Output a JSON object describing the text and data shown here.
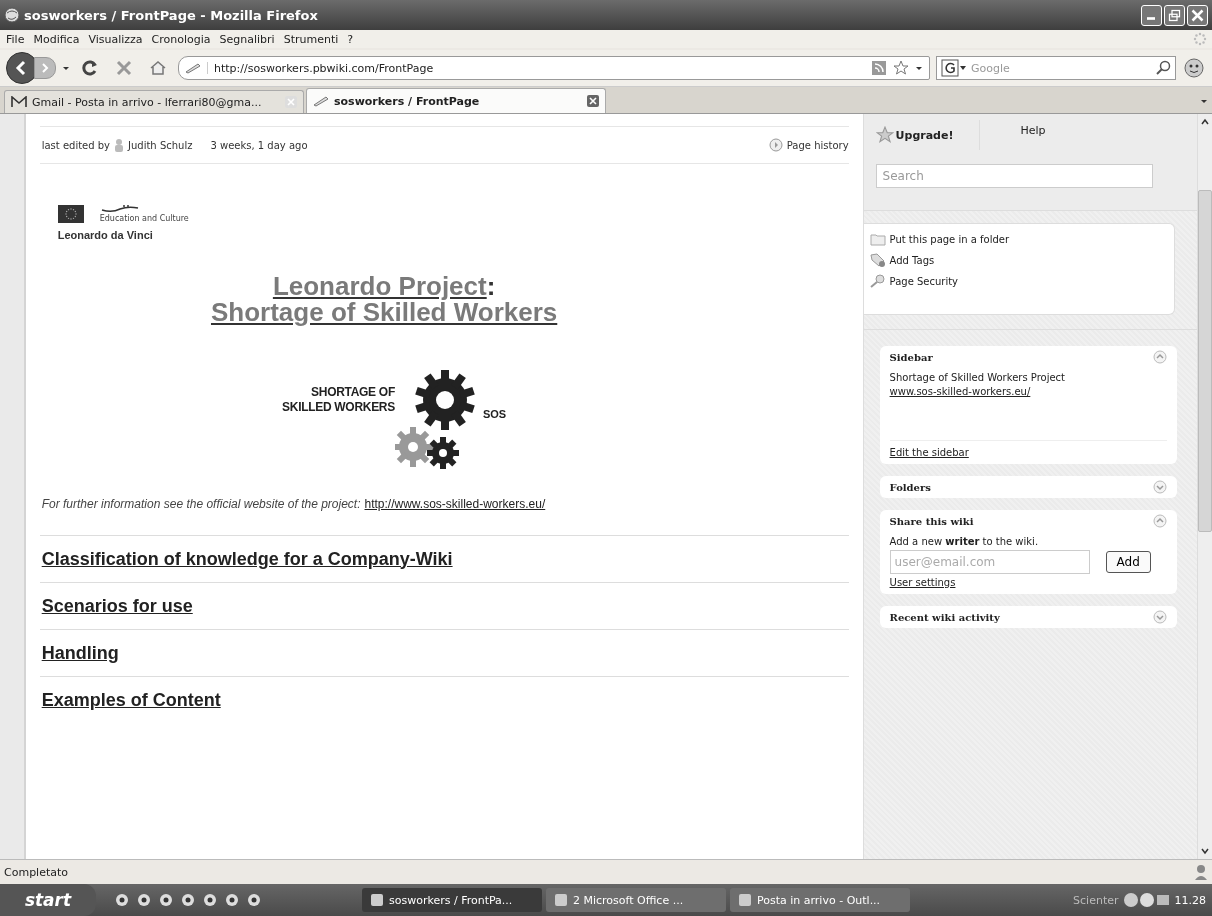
{
  "window": {
    "title": "sosworkers / FrontPage - Mozilla Firefox"
  },
  "menu": [
    "File",
    "Modifica",
    "Visualizza",
    "Cronologia",
    "Segnalibri",
    "Strumenti",
    "?"
  ],
  "toolbar": {
    "url": "http://sosworkers.pbwiki.com/FrontPage",
    "search_placeholder": "Google"
  },
  "tabs": [
    {
      "label": "Gmail - Posta in arrivo - lferrari80@gma...",
      "selected": false
    },
    {
      "label": "sosworkers / FrontPage",
      "selected": true
    }
  ],
  "page": {
    "edited_label": "last edited by",
    "author": "Judith Schulz",
    "edited_ago": "3 weeks, 1 day ago",
    "history": "Page history",
    "logo_small": "Education and Culture",
    "logo_caption": "Leonardo da Vinci",
    "title_link": "Leonardo Project",
    "title_colon": ":",
    "subtitle_link": "Shortage of Skilled Workers",
    "sos_logo": {
      "line1": "SHORTAGE OF",
      "line2": "SKILLED WORKERS",
      "badge": "SOS"
    },
    "info_text": "For further information see the official website of the project:",
    "info_link": "http://www.sos-skilled-workers.eu/",
    "sections": [
      "Classification of knowledge for a Company-Wiki",
      "Scenarios for use",
      "Handling",
      "Examples of Content"
    ]
  },
  "sidebar": {
    "upgrade": "Upgrade!",
    "help": "Help",
    "search_placeholder": "Search",
    "actions": [
      {
        "label": "Put this page in a folder",
        "kind": "folder"
      },
      {
        "label": "Add Tags",
        "kind": "tag"
      },
      {
        "label": "Page Security",
        "kind": "key"
      }
    ],
    "panels": [
      {
        "title": "Sidebar",
        "expanded": true,
        "kind": "text",
        "text": "Shortage of Skilled Workers Project",
        "link": "www.sos-skilled-workers.eu/",
        "footer_link": "Edit the sidebar"
      },
      {
        "title": "Folders",
        "expanded": false,
        "kind": "empty"
      },
      {
        "title": "Share this wiki",
        "expanded": true,
        "kind": "share",
        "text": "Add a new **writer** to the wiki.",
        "placeholder": "user@email.com",
        "button": "Add",
        "footer_link": "User settings"
      },
      {
        "title": "Recent wiki activity",
        "expanded": false,
        "kind": "empty"
      }
    ]
  },
  "status": "Completato",
  "taskbar": {
    "start": "start",
    "tasks": [
      {
        "label": "sosworkers / FrontPa...",
        "selected": true
      },
      {
        "label": "2 Microsoft Office ...",
        "selected": false
      },
      {
        "label": "Posta in arrivo - Outl...",
        "selected": false
      }
    ],
    "tray_label": "Scienter",
    "clock": "11.28"
  }
}
